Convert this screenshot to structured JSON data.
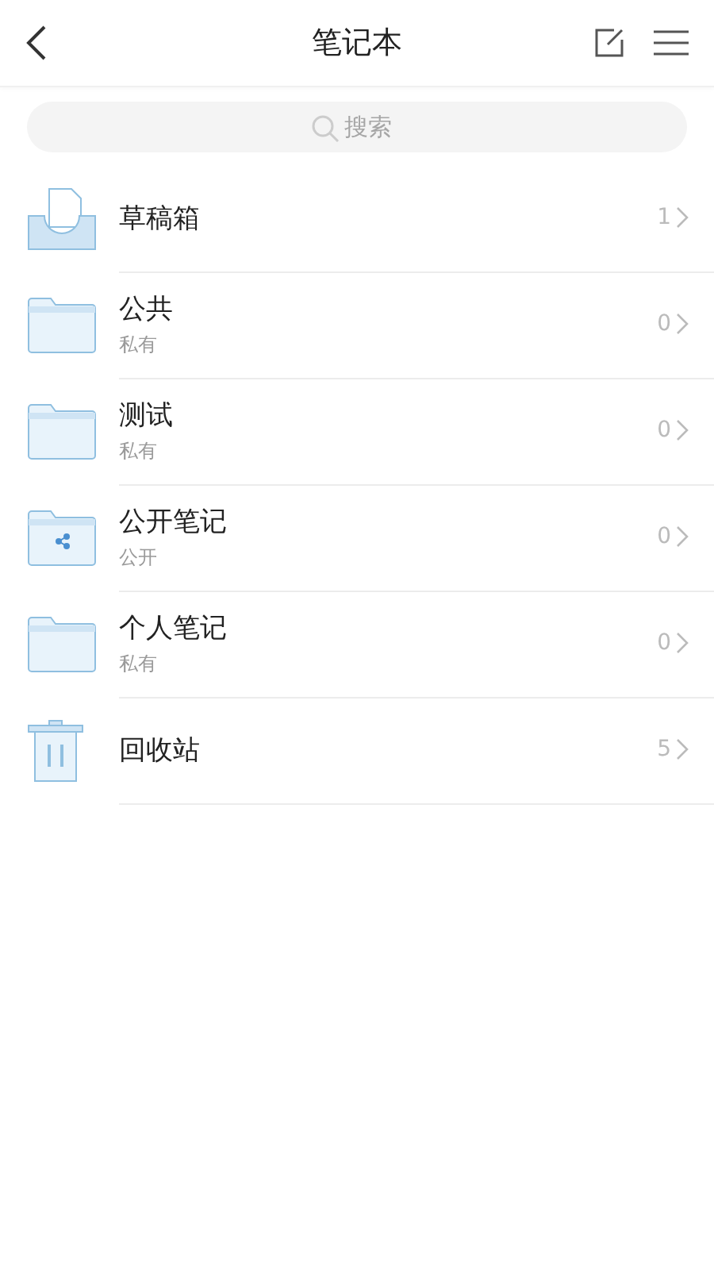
{
  "header": {
    "title": "笔记本"
  },
  "search": {
    "placeholder": "搜索"
  },
  "notebooks": [
    {
      "kind": "drafts",
      "name": "草稿箱",
      "count": "1"
    },
    {
      "kind": "folder",
      "name": "公共",
      "subtitle": "私有",
      "count": "0"
    },
    {
      "kind": "folder",
      "name": "测试",
      "subtitle": "私有",
      "count": "0"
    },
    {
      "kind": "shared",
      "name": "公开笔记",
      "subtitle": "公开",
      "count": "0"
    },
    {
      "kind": "folder",
      "name": "个人笔记",
      "subtitle": "私有",
      "count": "0"
    },
    {
      "kind": "trash",
      "name": "回收站",
      "count": "5"
    }
  ]
}
